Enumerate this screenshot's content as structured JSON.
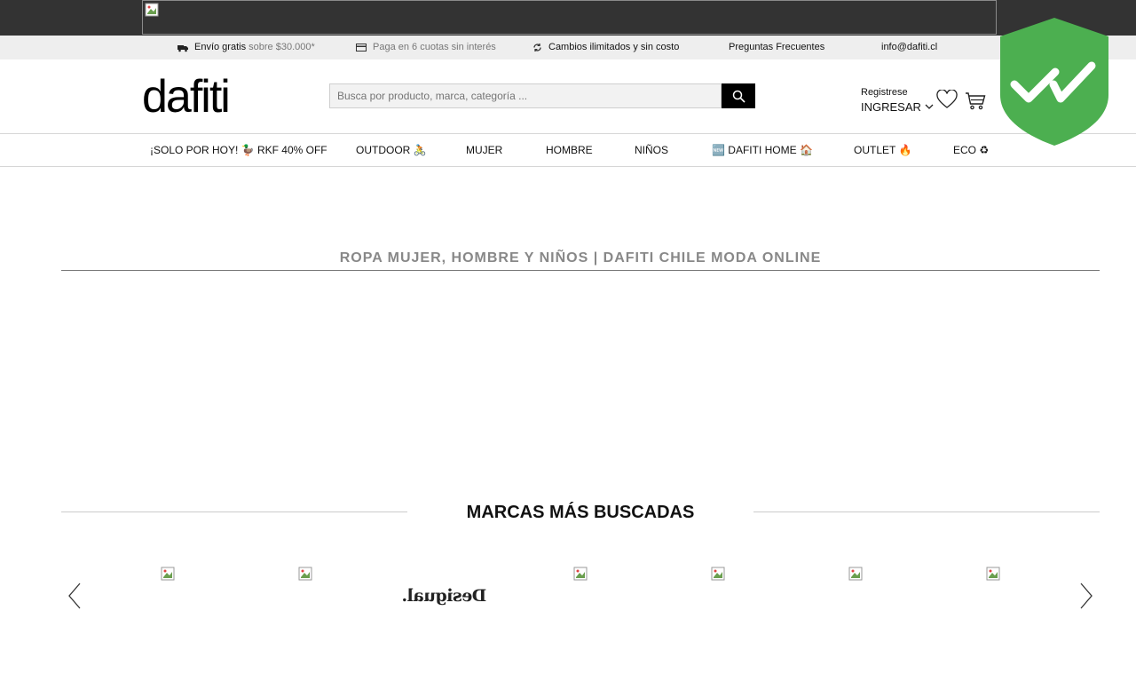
{
  "infobar": {
    "shipping_strong": "Envío gratis",
    "shipping_light": "sobre $30.000*",
    "installments": "Paga en 6 cuotas sin interés",
    "exchanges": "Cambios ilimitados y sin costo",
    "faq": "Preguntas Frecuentes",
    "email": "info@dafiti.cl"
  },
  "header": {
    "logo": "dafiti",
    "search_placeholder": "Busca por producto, marca, categoría ...",
    "register": "Registrese",
    "login": "INGRESAR"
  },
  "nav": {
    "items": [
      "¡SOLO POR HOY! 🦆 RKF 40% OFF",
      "OUTDOOR 🚴",
      "MUJER",
      "HOMBRE",
      "NIÑOS",
      "🆕 DAFITI HOME 🏠",
      "OUTLET 🔥",
      "ECO ♻"
    ]
  },
  "seo": {
    "title": "ROPA MUJER, HOMBRE Y NIÑOS | DAFITI CHILE MODA ONLINE"
  },
  "brands": {
    "title": "MARCAS MÁS BUSCADAS",
    "desigual_logo": "Desigual."
  },
  "colors": {
    "topbar": "#333333",
    "infobar": "#eeeeee",
    "shield": "#4caf50"
  }
}
